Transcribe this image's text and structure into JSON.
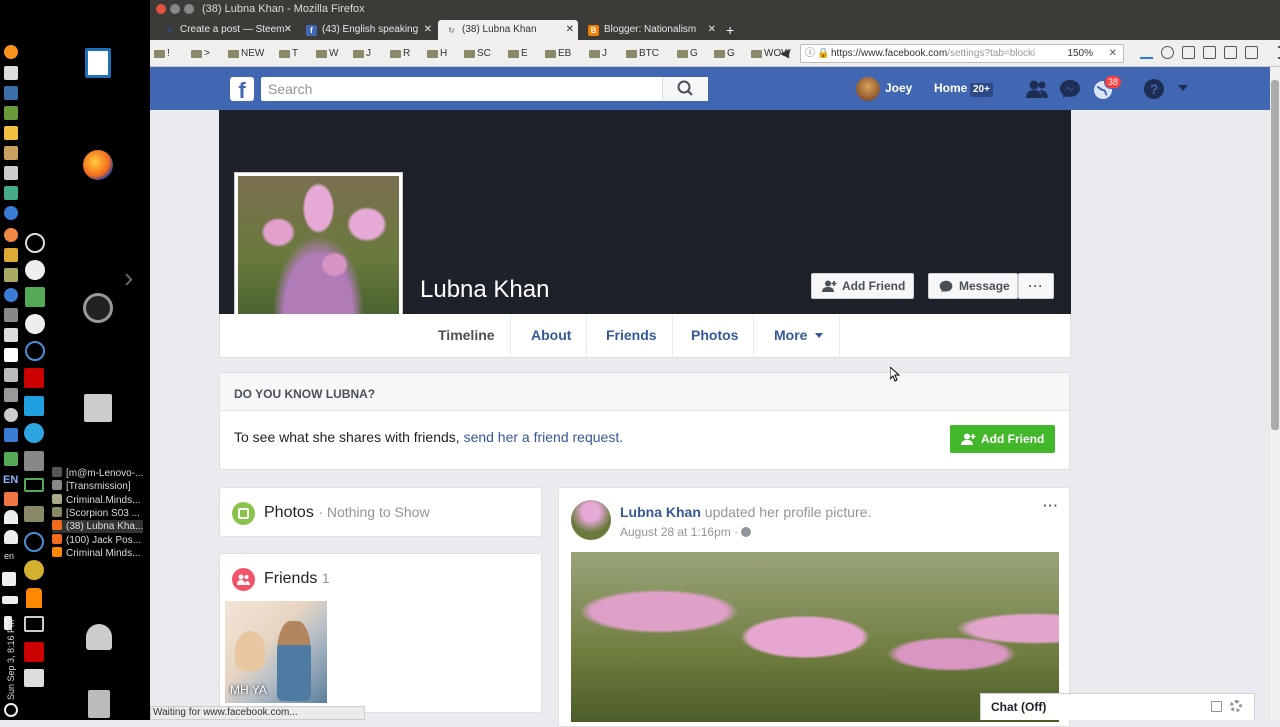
{
  "window": {
    "title": "(38) Lubna Khan - Mozilla Firefox"
  },
  "tabs": [
    {
      "label": "Create a post — Steem",
      "favicon": "V"
    },
    {
      "label": "(43) English speaking",
      "favicon": "f"
    },
    {
      "label": "(38) Lubna Khan",
      "favicon": "↻"
    },
    {
      "label": "Blogger: Nationalism",
      "favicon": "B"
    }
  ],
  "bookmarks": [
    "!",
    ">",
    "NEW",
    "T",
    "W",
    "J",
    "R",
    "H",
    "SC",
    "E",
    "EB",
    "J",
    "BTC",
    "G",
    "G",
    "WOW"
  ],
  "url": {
    "domain": "https://www.facebook.com",
    "path": "/settings?tab=blocki",
    "zoom": "150%"
  },
  "sidebar": {
    "windows": [
      "[m@m-Lenovo-...",
      "[Transmission]",
      "Criminal.Minds...",
      "[Scorpion S03 ...",
      "(38) Lubna Kha...",
      "(100) Jack Pos...",
      "Criminal Minds..."
    ],
    "lang": "EN",
    "lang2": "en",
    "clock": "Sun Sep 3, 8:16 PM"
  },
  "fb": {
    "logo": "f",
    "search_placeholder": "Search",
    "user": "Joey",
    "home": "Home",
    "home_badge": "20+",
    "notif_badge": "38"
  },
  "profile": {
    "name": "Lubna Khan",
    "add_friend": "Add Friend",
    "message": "Message",
    "more_dots": "···",
    "tabs": [
      "Timeline",
      "About",
      "Friends",
      "Photos",
      "More"
    ]
  },
  "dyk": {
    "title": "DO YOU KNOW LUBNA?",
    "text": "To see what she shares with friends, ",
    "link": "send her a friend request.",
    "button": "Add Friend"
  },
  "photos": {
    "title": "Photos",
    "sub": "Nothing to Show"
  },
  "friends": {
    "title": "Friends",
    "count": "1",
    "friend_name": "MH YA"
  },
  "post": {
    "author": "Lubna Khan",
    "action": "updated her profile picture.",
    "date": "August 28 at 1:16pm",
    "sep": "·",
    "menu": "···"
  },
  "chat": {
    "label": "Chat (Off)"
  },
  "status": {
    "text": "Waiting for www.facebook.com..."
  }
}
